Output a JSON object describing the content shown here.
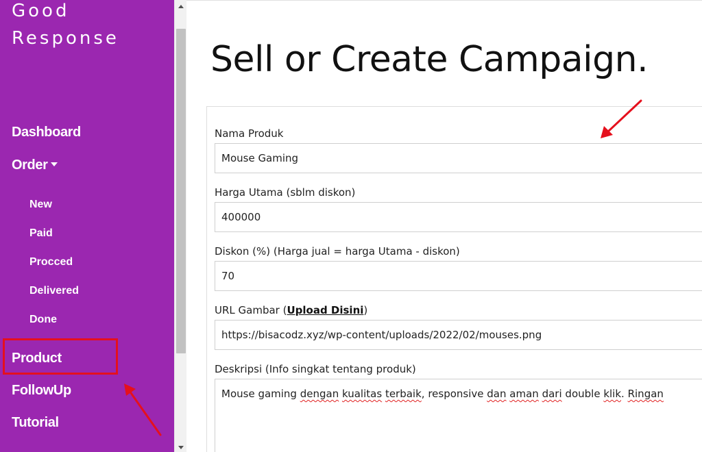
{
  "sidebar": {
    "brand_line1": "Good",
    "brand_line2": "Response",
    "items": {
      "dashboard": "Dashboard",
      "order": "Order",
      "new": "New",
      "paid": "Paid",
      "procced": "Procced",
      "delivered": "Delivered",
      "done": "Done",
      "product": "Product",
      "followup": "FollowUp",
      "tutorial": "Tutorial"
    }
  },
  "main": {
    "title": "Sell or Create Campaign.",
    "form": {
      "nama_label": "Nama Produk",
      "nama_value": "Mouse Gaming",
      "harga_label": "Harga Utama (sblm diskon)",
      "harga_value": "400000",
      "diskon_label": "Diskon (%) (Harga jual = harga Utama - diskon)",
      "diskon_value": "70",
      "url_label_prefix": "URL Gambar (",
      "url_link": "Upload Disini",
      "url_label_suffix": ")",
      "url_value": "https://bisacodz.xyz/wp-content/uploads/2022/02/mouses.png",
      "deskripsi_label": "Deskripsi (Info singkat tentang produk)",
      "deskripsi_words": [
        "Mouse gaming ",
        "dengan",
        " ",
        "kualitas",
        " ",
        "terbaik",
        ", responsive ",
        "dan",
        " ",
        "aman",
        " ",
        "dari",
        " double ",
        "klik",
        ". ",
        "Ringan"
      ]
    }
  },
  "colors": {
    "sidebar_bg": "#9b27b0",
    "annotation_red": "#e5101d"
  },
  "icons": {
    "order_caret": "caret-down-icon",
    "scroll_up": "scroll-up-arrow-icon",
    "scroll_down": "scroll-down-arrow-icon"
  }
}
